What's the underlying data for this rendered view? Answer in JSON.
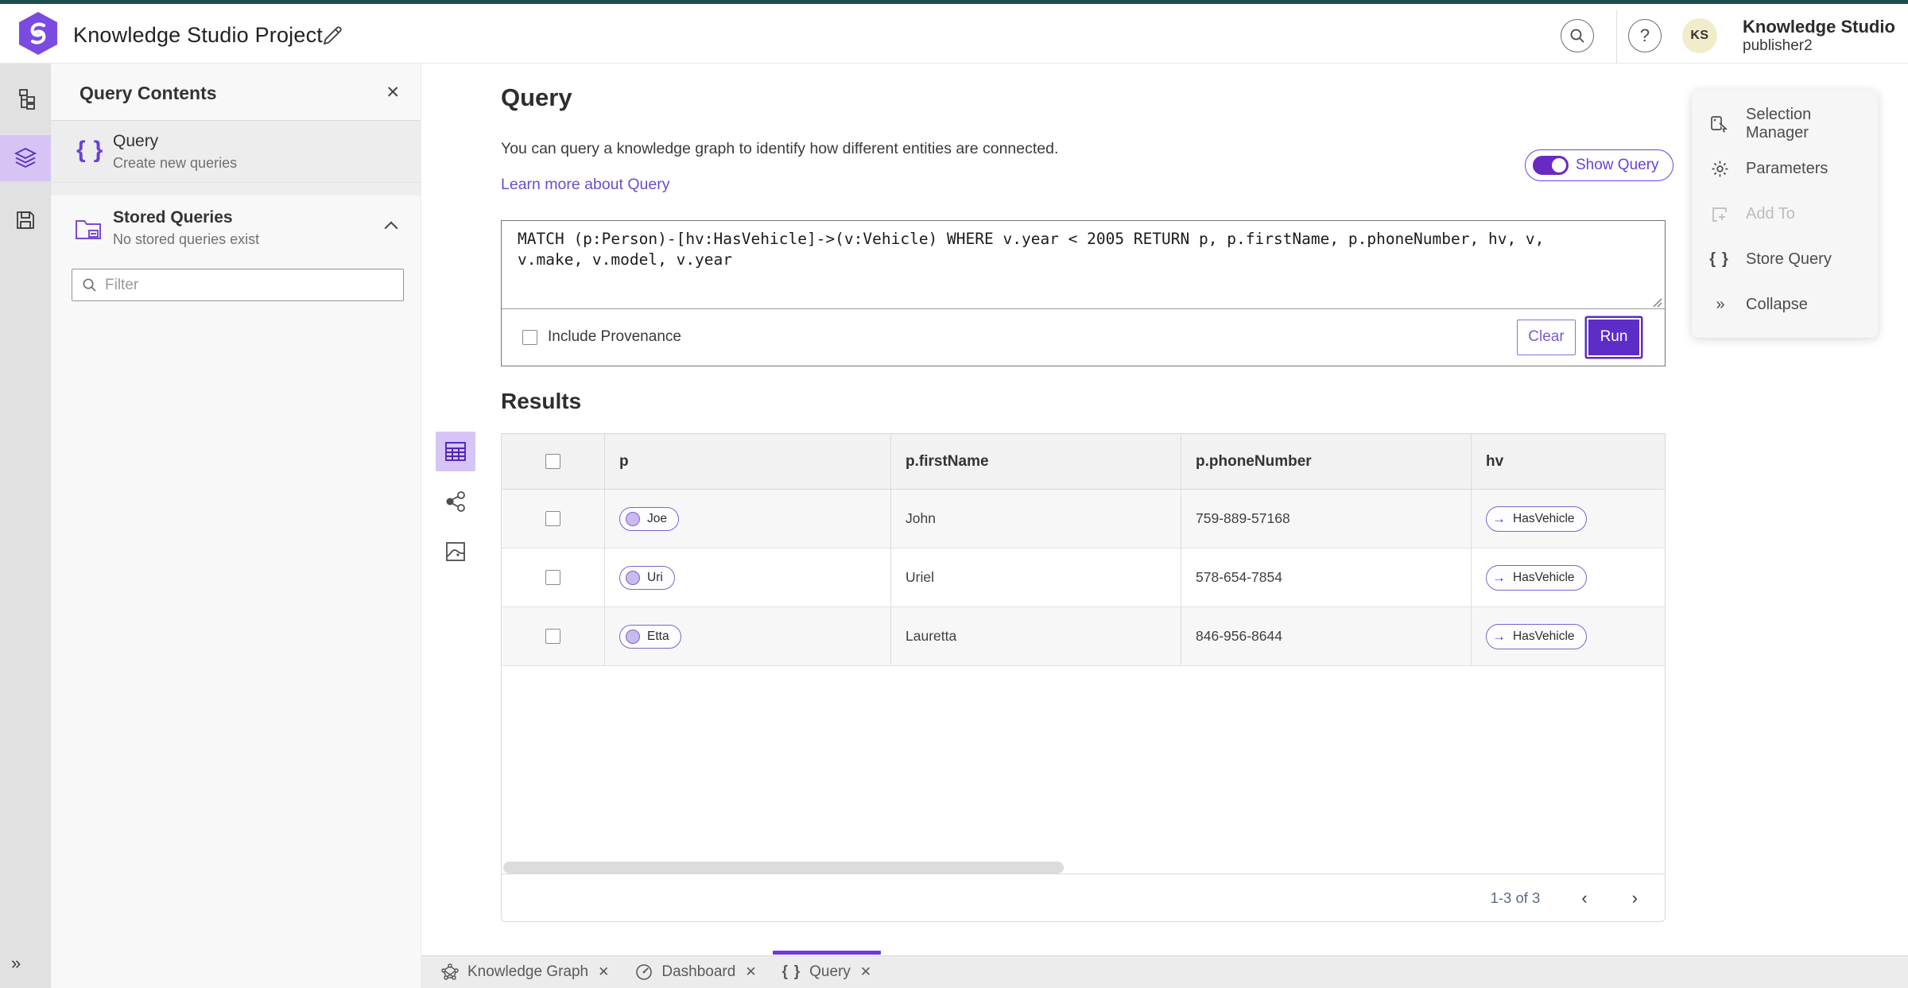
{
  "header": {
    "title": "Knowledge Studio Project",
    "user_name": "Knowledge Studio",
    "user_role": "publisher2",
    "avatar_initials": "KS"
  },
  "sidebar": {
    "panel_title": "Query Contents",
    "query_item": {
      "title": "Query",
      "subtitle": "Create new queries"
    },
    "stored_queries": {
      "title": "Stored Queries",
      "subtitle": "No stored queries exist"
    },
    "filter_placeholder": "Filter"
  },
  "query_section": {
    "title": "Query",
    "description": "You can query a knowledge graph to identify how different entities are connected.",
    "learn_more": "Learn more about Query",
    "show_query_label": "Show Query",
    "query_text": "MATCH (p:Person)-[hv:HasVehicle]->(v:Vehicle) WHERE v.year < 2005 RETURN p, p.firstName, p.phoneNumber, hv, v, v.make, v.model, v.year",
    "include_provenance_label": "Include Provenance",
    "clear_label": "Clear",
    "run_label": "Run"
  },
  "results": {
    "title": "Results",
    "columns": [
      "p",
      "p.firstName",
      "p.phoneNumber",
      "hv"
    ],
    "rows": [
      {
        "p": "Joe",
        "firstName": "John",
        "phoneNumber": "759-889-57168",
        "hv": "HasVehicle"
      },
      {
        "p": "Uri",
        "firstName": "Uriel",
        "phoneNumber": "578-654-7854",
        "hv": "HasVehicle"
      },
      {
        "p": "Etta",
        "firstName": "Lauretta",
        "phoneNumber": "846-956-8644",
        "hv": "HasVehicle"
      }
    ],
    "pagination": "1-3 of 3",
    "edge_arrow": "→"
  },
  "right_panel": {
    "items": [
      {
        "label": "Selection Manager"
      },
      {
        "label": "Parameters"
      },
      {
        "label": "Add To"
      },
      {
        "label": "Store Query"
      },
      {
        "label": "Collapse"
      }
    ]
  },
  "tabs": [
    {
      "label": "Knowledge Graph"
    },
    {
      "label": "Dashboard"
    },
    {
      "label": "Query"
    }
  ],
  "colors": {
    "primary_purple": "#5e2cc7",
    "light_purple_bg": "#d6c5f4",
    "accent_teal": "#1d4d4d",
    "link_purple": "#6a4ec9",
    "avatar_bg": "#f1ecca"
  }
}
